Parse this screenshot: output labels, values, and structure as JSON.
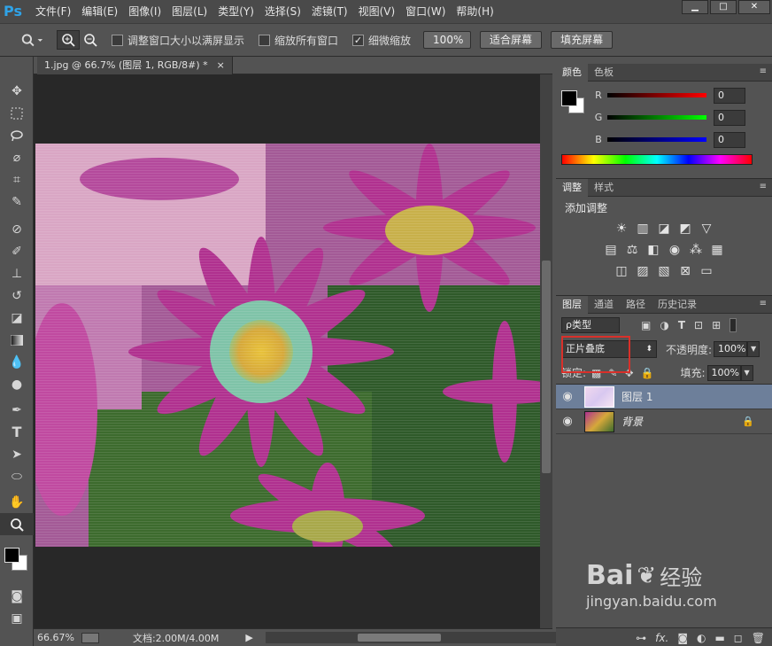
{
  "app": {
    "logo": "Ps"
  },
  "menu": [
    "文件(F)",
    "编辑(E)",
    "图像(I)",
    "图层(L)",
    "类型(Y)",
    "选择(S)",
    "滤镜(T)",
    "视图(V)",
    "窗口(W)",
    "帮助(H)"
  ],
  "window_controls": [
    "▁",
    "□",
    "✕"
  ],
  "options": {
    "resize_windows": "调整窗口大小以满屏显示",
    "zoom_all": "缩放所有窗口",
    "scrubby_zoom": "细微缩放",
    "scrubby_checked": "✓",
    "zoom_100": "100%",
    "fit_screen": "适合屏幕",
    "fill_screen": "填充屏幕"
  },
  "document": {
    "tab_title": "1.jpg @ 66.7% (图层 1, RGB/8#) *",
    "tab_close": "×",
    "zoom": "66.67%",
    "doc_size": "文档:2.00M/4.00M"
  },
  "color_panel": {
    "tabs": [
      "颜色",
      "色板"
    ],
    "r_label": "R",
    "g_label": "G",
    "b_label": "B",
    "r_value": "0",
    "g_value": "0",
    "b_value": "0"
  },
  "adjust_panel": {
    "tabs": [
      "调整",
      "样式"
    ],
    "title": "添加调整"
  },
  "layers_panel": {
    "tabs": [
      "图层",
      "通道",
      "路径",
      "历史记录"
    ],
    "filter": "ρ类型",
    "blend_mode": "正片叠底",
    "opacity_label": "不透明度:",
    "opacity_value": "100%",
    "lock_label": "锁定:",
    "fill_label": "填充:",
    "fill_value": "100%",
    "layers": [
      {
        "name": "图层 1",
        "selected": true
      },
      {
        "name": "背景",
        "selected": false
      }
    ]
  },
  "watermark": {
    "brand": "Bai",
    "brand2": "经验",
    "url": "jingyan.baidu.com"
  },
  "colors": {
    "accent": "#2fa3e8",
    "highlight_box": "#d9302a",
    "selected_layer": "#6d7f9a"
  }
}
